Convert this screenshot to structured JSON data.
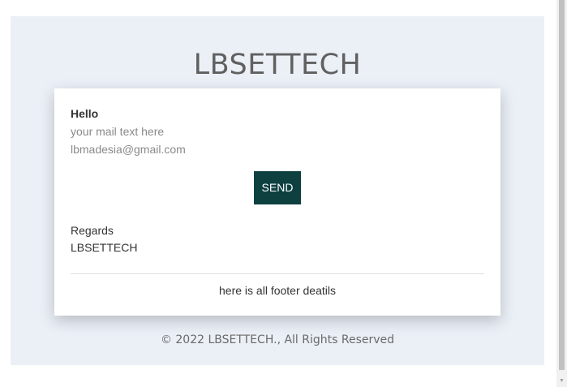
{
  "header": {
    "brand": "LBSETTECH"
  },
  "email": {
    "greeting": "Hello",
    "message": "your mail text here",
    "address": "lbmadesia@gmail.com",
    "send_label": "SEND",
    "regards": "Regards",
    "signature": "LBSETTECH",
    "footer_details": "here is all footer deatils"
  },
  "footer": {
    "copyright": "© 2022 LBSETTECH., All Rights Reserved"
  },
  "colors": {
    "page_bg": "#ebf0f7",
    "card_bg": "#ffffff",
    "button_bg": "#0e4040",
    "button_text": "#ffffff"
  },
  "scrollbar": {
    "arrow_icon": "scroll-down-arrow"
  }
}
